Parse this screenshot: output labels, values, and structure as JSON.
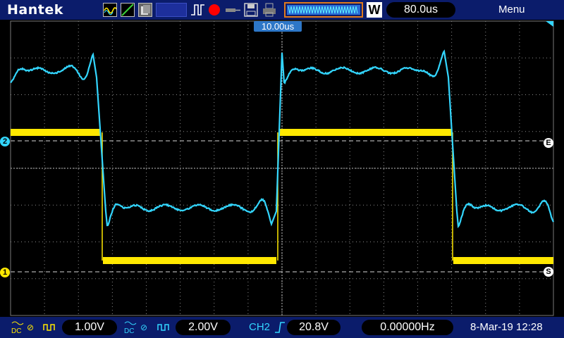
{
  "header": {
    "brand": "Hantek",
    "timebase": "80.0us",
    "timebase_mode": "W",
    "menu": "Menu",
    "trigger_delay": "10.00us"
  },
  "channels": [
    {
      "id": "1",
      "coupling": "DC",
      "scale": "1.00V",
      "color": "#ffe800"
    },
    {
      "id": "2",
      "coupling": "DC",
      "scale": "2.00V",
      "color": "#33d6ff"
    }
  ],
  "trigger": {
    "source": "CH2",
    "edge": "rising",
    "level": "20.8V"
  },
  "frequency": "0.00000Hz",
  "datetime": "8-Mar-19 12:28",
  "markers": {
    "ch1": "1",
    "ch2": "2",
    "edge": "E",
    "start": "S"
  },
  "icons": [
    "waveform-icon",
    "ramp-icon",
    "persistence-icon",
    "pulse-icon",
    "record-icon",
    "probe-icon",
    "save-icon",
    "print-icon",
    "trigger-edge-icon"
  ],
  "colors": {
    "background": "#0b1c6b",
    "ch1": "#ffe800",
    "ch2": "#33d6ff",
    "accent": "#e07a1e"
  }
}
